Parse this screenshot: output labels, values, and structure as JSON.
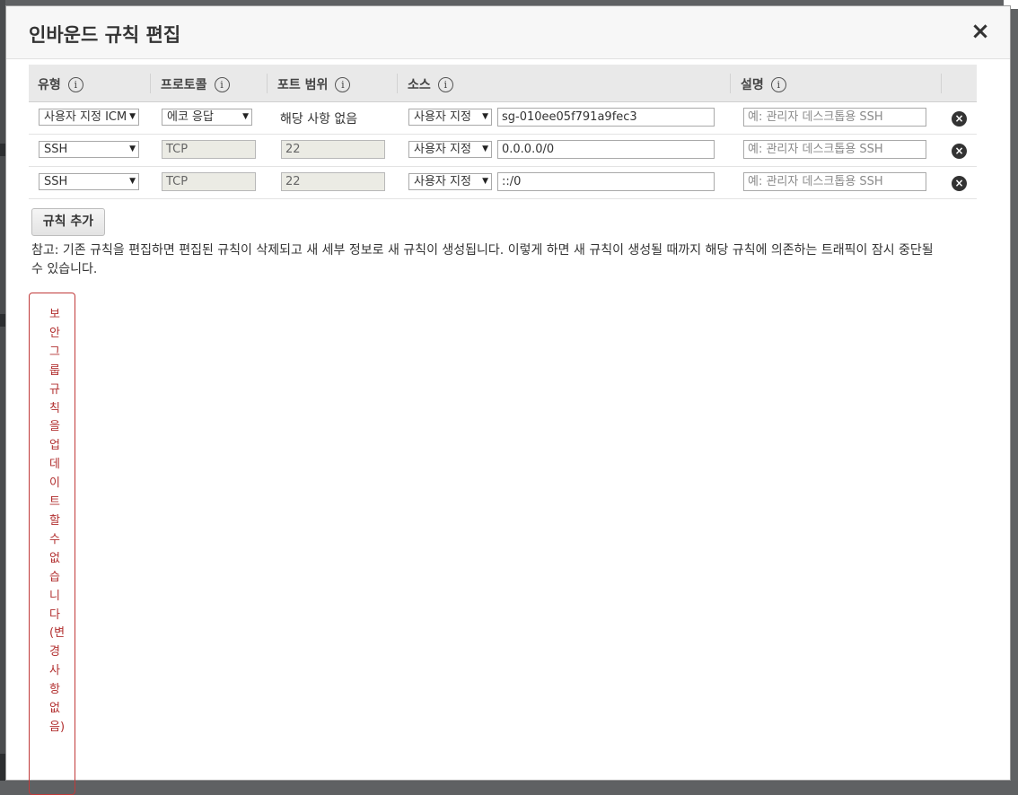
{
  "colors": {
    "error": "#b23030",
    "header_bg": "#e9e9e9"
  },
  "modal": {
    "title": "인바운드 규칙 편집",
    "close_label": "×"
  },
  "table": {
    "headers": {
      "type": "유형",
      "protocol": "프로토콜",
      "port_range": "포트 범위",
      "source": "소스",
      "description": "설명",
      "info_icon": "i"
    },
    "rows": [
      {
        "type": "사용자 지정 ICMP",
        "protocol": "에코 응답",
        "port": "해당 사항 없음",
        "source_type": "사용자 지정",
        "source_value": "sg-010ee05f791a9fec3",
        "description_placeholder": "예: 관리자 데스크톱용 SSH"
      },
      {
        "type": "SSH",
        "protocol": "TCP",
        "port": "22",
        "source_type": "사용자 지정",
        "source_value": "0.0.0.0/0",
        "description_placeholder": "예: 관리자 데스크톱용 SSH"
      },
      {
        "type": "SSH",
        "protocol": "TCP",
        "port": "22",
        "source_type": "사용자 지정",
        "source_value": "::/0",
        "description_placeholder": "예: 관리자 데스크톱용 SSH"
      }
    ],
    "delete_icon": "×",
    "dropdown_arrow": "▼"
  },
  "add_rule_label": "규칙 추가",
  "note": "참고: 기존 규칙을 편집하면 편집된 규칙이 삭제되고 새 세부 정보로 새 규칙이 생성됩니다. 이렇게 하면 새 규칙이 생성될 때까지 해당 규칙에 의존하는 트래픽이 잠시 중단될 수 있습니다.",
  "error_message": "보안그룹규칙을업데이트할수없습니다(변경사항없음)"
}
